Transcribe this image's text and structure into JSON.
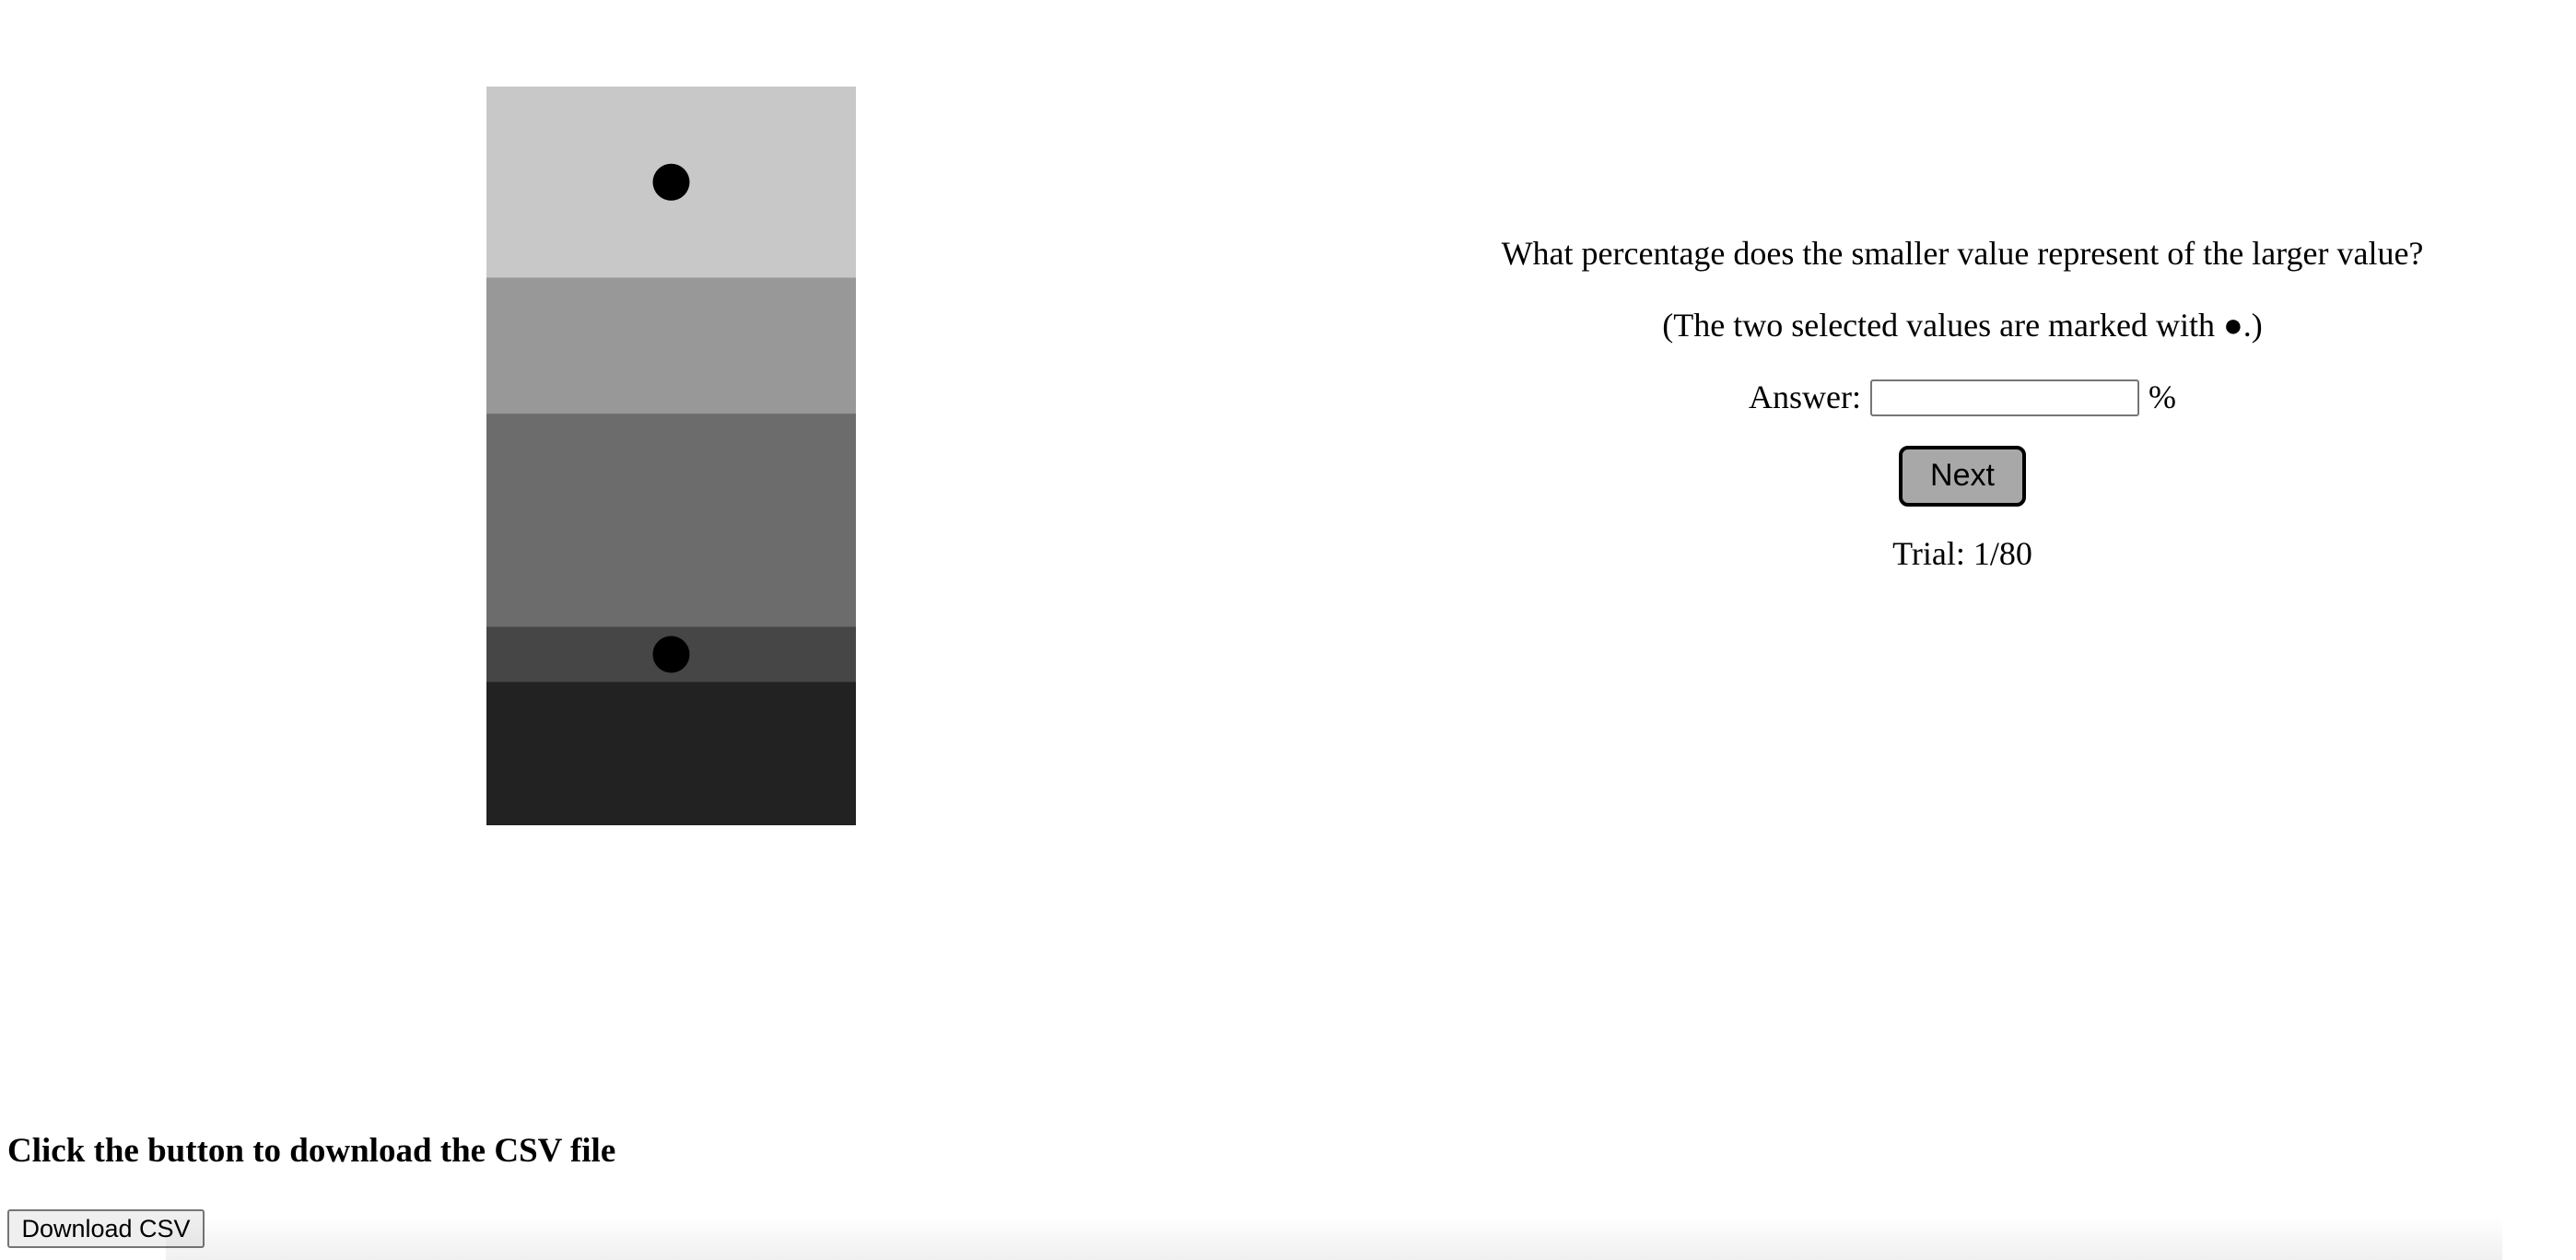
{
  "question": {
    "prompt": "What percentage does the smaller value represent of the larger value?",
    "hint": "(The two selected values are marked with ●.)",
    "answer_label": "Answer:",
    "answer_value": "",
    "answer_placeholder": "",
    "unit": "%",
    "next_label": "Next",
    "trial": "Trial: 1/80"
  },
  "download": {
    "heading": "Click the button to download the CSV file",
    "button_label": "Download CSV"
  },
  "chart_data": {
    "type": "stacked-bar",
    "orientation": "vertical",
    "axes": "none",
    "marker_color": "#000000",
    "segments_top_to_bottom": [
      {
        "value": 26,
        "color": "#c8c8c8",
        "marked": true
      },
      {
        "value": 18.5,
        "color": "#989898",
        "marked": false
      },
      {
        "value": 29,
        "color": "#6c6c6c",
        "marked": false
      },
      {
        "value": 7.5,
        "color": "#464646",
        "marked": true
      },
      {
        "value": 19.5,
        "color": "#222222",
        "marked": false
      }
    ]
  }
}
